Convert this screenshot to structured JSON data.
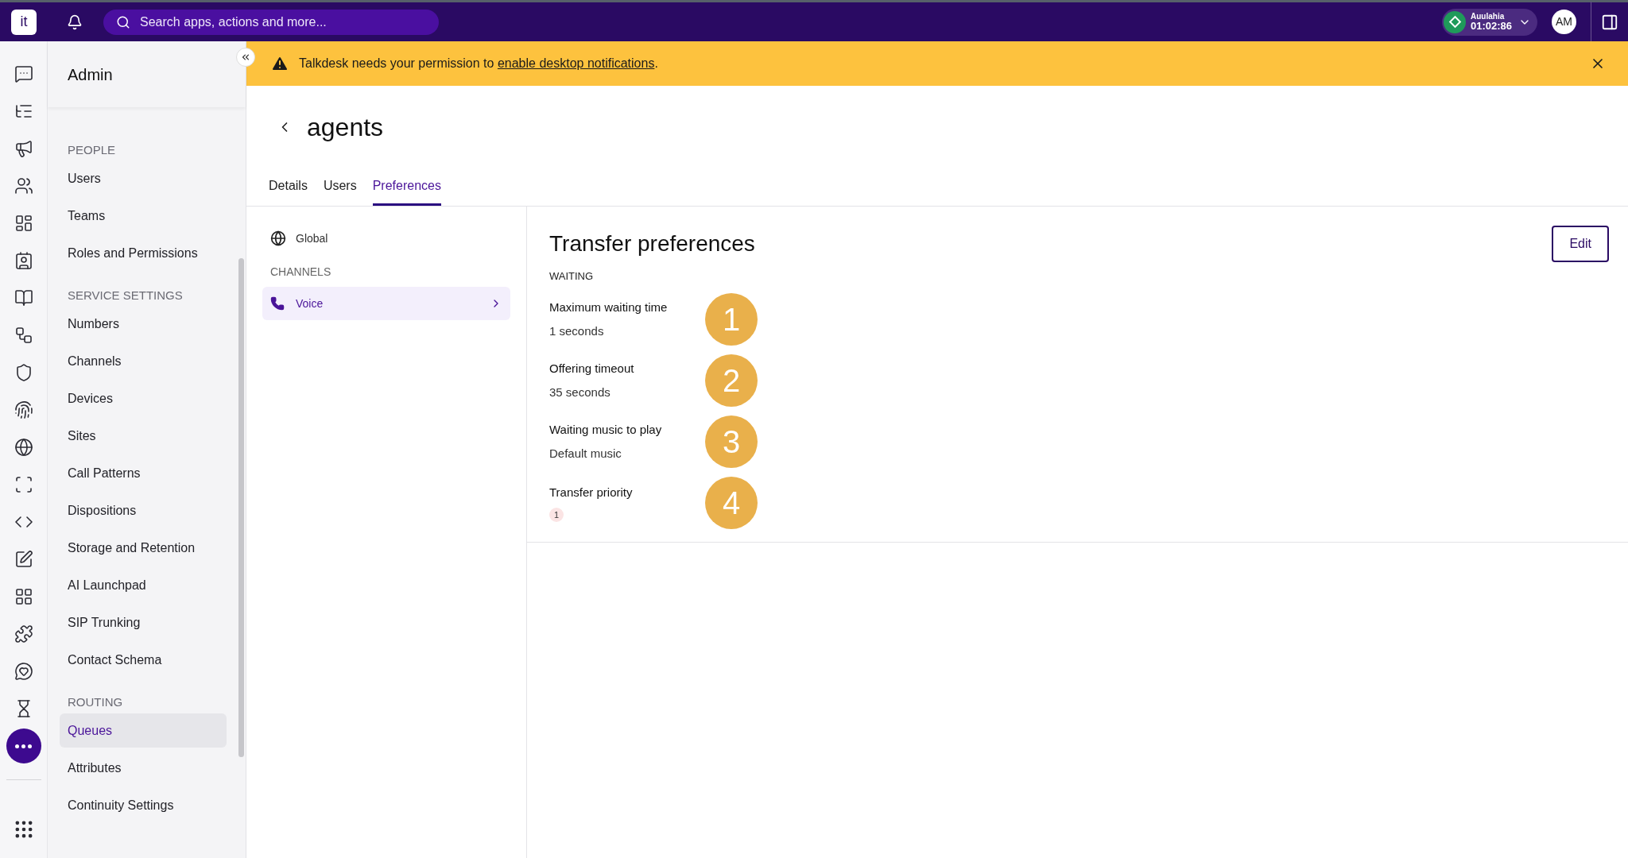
{
  "topbar": {
    "logo": "it",
    "search": {
      "placeholder": "Search apps, actions and more..."
    },
    "status": {
      "name": "Auulahia",
      "timer": "01:02:86"
    },
    "avatar": "AM"
  },
  "banner": {
    "text": "Talkdesk needs your permission to ",
    "link": "enable desktop notifications",
    "end": "."
  },
  "rail": {
    "more_selected": true
  },
  "admin": {
    "title": "Admin",
    "sections": [
      {
        "heading": "PEOPLE",
        "items": [
          {
            "label": "Users",
            "selected": false
          },
          {
            "label": "Teams",
            "selected": false
          },
          {
            "label": "Roles and Permissions",
            "selected": false
          }
        ]
      },
      {
        "heading": "SERVICE SETTINGS",
        "items": [
          {
            "label": "Numbers",
            "selected": false
          },
          {
            "label": "Channels",
            "selected": false
          },
          {
            "label": "Devices",
            "selected": false
          },
          {
            "label": "Sites",
            "selected": false
          },
          {
            "label": "Call Patterns",
            "selected": false
          },
          {
            "label": "Dispositions",
            "selected": false
          },
          {
            "label": "Storage and Retention",
            "selected": false
          },
          {
            "label": "AI Launchpad",
            "selected": false
          },
          {
            "label": "SIP Trunking",
            "selected": false
          },
          {
            "label": "Contact Schema",
            "selected": false
          }
        ]
      },
      {
        "heading": "ROUTING",
        "items": [
          {
            "label": "Queues",
            "selected": true
          },
          {
            "label": "Attributes",
            "selected": false
          },
          {
            "label": "Continuity Settings",
            "selected": false
          }
        ]
      }
    ]
  },
  "page": {
    "title": "agents",
    "tabs": [
      {
        "label": "Details",
        "selected": false
      },
      {
        "label": "Users",
        "selected": false
      },
      {
        "label": "Preferences",
        "selected": true
      }
    ]
  },
  "scope": {
    "global": "Global",
    "channels_heading": "CHANNELS",
    "channels": [
      {
        "label": "Voice",
        "selected": true
      }
    ]
  },
  "preferences": {
    "title": "Transfer preferences",
    "edit": "Edit",
    "section": "WAITING",
    "fields": [
      {
        "label": "Maximum waiting time",
        "value": "1 seconds",
        "kind": "text",
        "callout": "1"
      },
      {
        "label": "Offering timeout",
        "value": "35 seconds",
        "kind": "text",
        "callout": "2"
      },
      {
        "label": "Waiting music to play",
        "value": "Default music",
        "kind": "text",
        "callout": "3"
      },
      {
        "label": "Transfer priority",
        "value": "1",
        "kind": "badge",
        "callout": "4"
      }
    ]
  }
}
